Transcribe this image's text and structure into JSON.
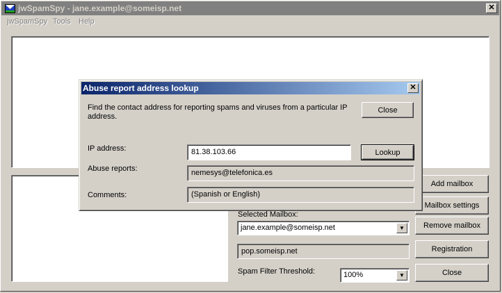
{
  "window": {
    "title": "jwSpamSpy - jane.example@someisp.net",
    "close_glyph": "✕",
    "icon": "app-envelope-icon"
  },
  "menu": [
    "jwSpamSpy",
    "Tools",
    "Help"
  ],
  "main": {
    "buttons": {
      "add_mailbox": "Add mailbox",
      "mailbox_settings": "Mailbox settings",
      "remove_mailbox": "Remove mailbox",
      "registration": "Registration",
      "close": "Close"
    },
    "selected_mailbox_label": "Selected Mailbox:",
    "selected_mailbox_value": "jane.example@someisp.net",
    "server_value": "pop.someisp.net",
    "spam_threshold_label": "Spam Filter Threshold:",
    "spam_threshold_value": "100%"
  },
  "dialog": {
    "title": "Abuse report address lookup",
    "close_glyph": "✕",
    "description": "Find the contact address for reporting spams and viruses from a particular IP address.",
    "close_button": "Close",
    "ip_label": "IP address:",
    "ip_value": "81.38.103.66",
    "lookup_button": "Lookup",
    "abuse_label": "Abuse reports:",
    "abuse_value": "nemesys@telefonica.es",
    "comments_label": "Comments:",
    "comments_value": "(Spanish or English)"
  },
  "colors": {
    "dialog_title_start": "#0a246a",
    "dialog_title_end": "#a6caf0",
    "face": "#d4d0c8"
  }
}
